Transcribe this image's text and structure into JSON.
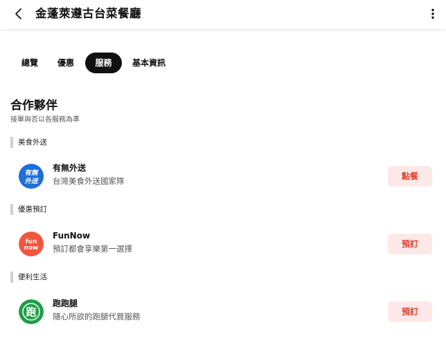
{
  "header": {
    "title": "金蓬萊遵古台菜餐廳",
    "back_icon": "chevron-left-icon",
    "more_icon": "more-vertical-icon"
  },
  "tabs": [
    {
      "label": "總覽",
      "active": false
    },
    {
      "label": "優惠",
      "active": false
    },
    {
      "label": "服務",
      "active": true
    },
    {
      "label": "基本資訊",
      "active": false
    }
  ],
  "section": {
    "title": "合作夥伴",
    "subtitle": "接單與否以各服務為準"
  },
  "groups": [
    {
      "label": "美食外送",
      "partner": {
        "name": "有無外送",
        "desc": "台灣美食外送國家隊",
        "button": "點餐",
        "logo_text_line1": "有無",
        "logo_text_line2": "外送",
        "logo_color": "#1e6fd9"
      }
    },
    {
      "label": "優惠預訂",
      "partner": {
        "name": "FunNow",
        "desc": "預訂都會享樂第一選擇",
        "button": "預訂",
        "logo_text_line1": "fun",
        "logo_text_line2": "now",
        "logo_color": "#f2553f"
      }
    },
    {
      "label": "便利生活",
      "partner": {
        "name": "跑跑腿",
        "desc": "隨心所欲的跑腿代買服務",
        "button": "預訂",
        "logo_text_line1": "跑",
        "logo_color": "#1e9e46"
      }
    }
  ],
  "colors": {
    "accent": "#e0432f",
    "button_bg": "#fde8e8",
    "active_tab_bg": "#111111"
  }
}
